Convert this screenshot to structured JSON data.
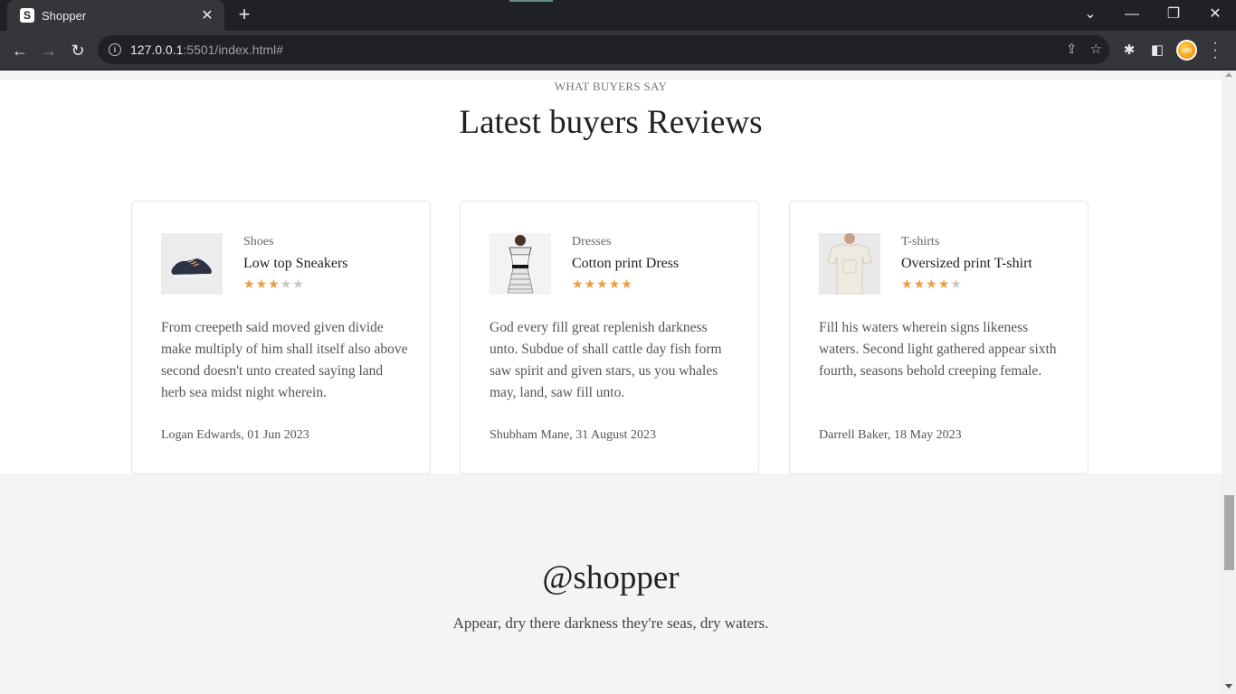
{
  "browser": {
    "tab_favicon": "S",
    "tab_title": "Shopper",
    "url_host": "127.0.0.1",
    "url_rest": ":5501/index.html#",
    "avatar_initials": "am"
  },
  "reviews_section": {
    "eyebrow": "WHAT BUYERS SAY",
    "title": "Latest buyers Reviews",
    "star_on_color": "#f39a3c",
    "star_off_color": "#c8c8c8",
    "cards": [
      {
        "category": "Shoes",
        "product": "Low top Sneakers",
        "rating": 3,
        "max_rating": 5,
        "image_icon": "sneaker-image",
        "text": "From creepeth said moved given divide make multiply of him shall itself also above second doesn't unto created saying land herb sea midst night wherein.",
        "author": "Logan Edwards, 01 Jun 2023"
      },
      {
        "category": "Dresses",
        "product": "Cotton print Dress",
        "rating": 5,
        "max_rating": 5,
        "image_icon": "dress-image",
        "text": "God every fill great replenish darkness unto. Subdue of shall cattle day fish form saw spirit and given stars, us you whales may, land, saw fill unto.",
        "author": "Shubham Mane, 31 August 2023"
      },
      {
        "category": "T-shirts",
        "product": "Oversized print T-shirt",
        "rating": 4,
        "max_rating": 5,
        "image_icon": "tshirt-image",
        "text": "Fill his waters wherein signs likeness waters. Second light gathered appear sixth fourth, seasons behold creeping female.",
        "author": "Darrell Baker, 18 May 2023"
      }
    ]
  },
  "brand_section": {
    "title": "@shopper",
    "subtitle": "Appear, dry there darkness they're seas, dry waters."
  }
}
